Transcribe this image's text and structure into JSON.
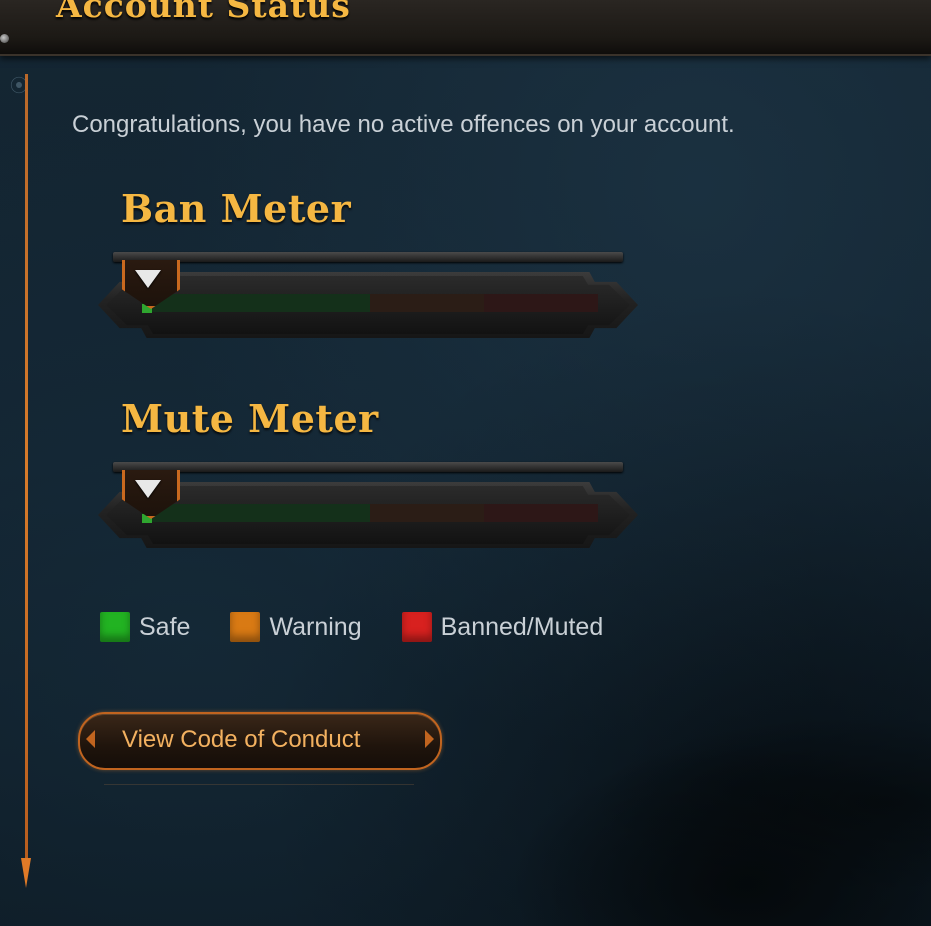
{
  "header": {
    "title": "Account Status"
  },
  "status_message": "Congratulations, you have no active offences on your account.",
  "meters": [
    {
      "title": "Ban Meter",
      "level": 0
    },
    {
      "title": "Mute Meter",
      "level": 0
    }
  ],
  "legend": [
    {
      "label": "Safe",
      "color": "#22b322"
    },
    {
      "label": "Warning",
      "color": "#d97a14"
    },
    {
      "label": "Banned/Muted",
      "color": "#d8211f"
    }
  ],
  "code_of_conduct_button": {
    "label": "View Code of Conduct"
  },
  "colors": {
    "accent": "#f5b742",
    "border_orange": "#c9691f",
    "background": "#132531",
    "text": "#c9d0d6"
  }
}
